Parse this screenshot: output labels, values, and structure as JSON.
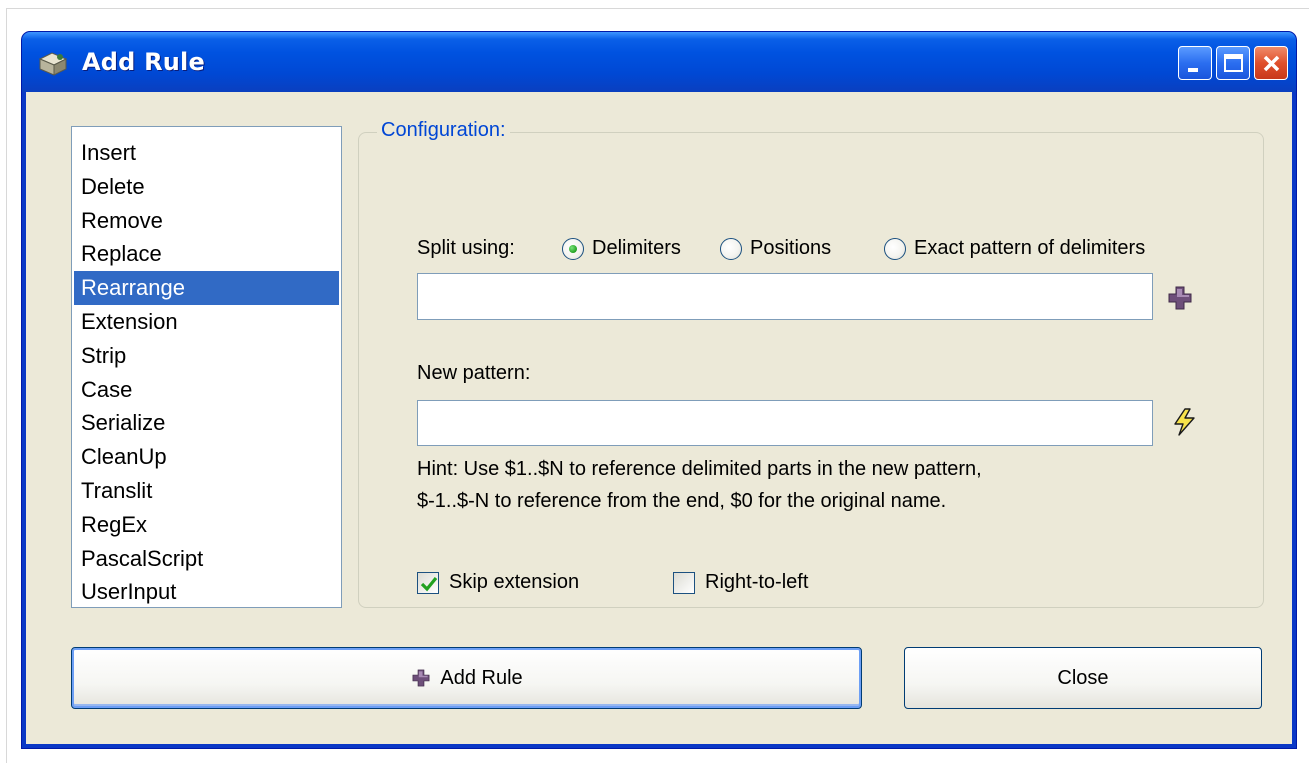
{
  "window": {
    "title": "Add Rule",
    "titlebar_color": "#0054e3",
    "controls": [
      "minimize-icon",
      "maximize-icon",
      "close-icon"
    ]
  },
  "rule_list": {
    "items": [
      "Insert",
      "Delete",
      "Remove",
      "Replace",
      "Rearrange",
      "Extension",
      "Strip",
      "Case",
      "Serialize",
      "CleanUp",
      "Translit",
      "RegEx",
      "PascalScript",
      "UserInput"
    ],
    "selected": "Rearrange",
    "selection_color": "#316ac5"
  },
  "config": {
    "legend": "Configuration:",
    "legend_color": "#0046d5",
    "split_label": "Split using:",
    "split_options": [
      "Delimiters",
      "Positions",
      "Exact pattern of delimiters"
    ],
    "split_selected": "Delimiters",
    "delimiters_value": "",
    "add_delimiter_icon": "plus-icon",
    "new_pattern_label": "New pattern:",
    "new_pattern_value": "",
    "pattern_menu_icon": "lightning-icon",
    "hint_line1": "Hint: Use $1..$N to reference delimited parts in the new pattern,",
    "hint_line2": "$-1..$-N to reference from the end, $0 for the original name.",
    "skip_extension_label": "Skip extension",
    "skip_extension_checked": true,
    "right_to_left_label": "Right-to-left",
    "right_to_left_checked": false
  },
  "buttons": {
    "add_rule_label": "Add Rule",
    "add_rule_icon": "plus-icon",
    "close_label": "Close"
  }
}
